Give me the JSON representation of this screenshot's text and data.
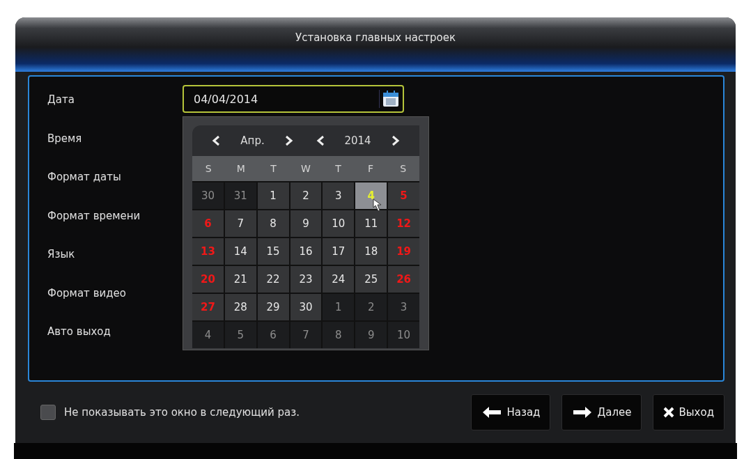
{
  "window": {
    "title": "Установка главных настроек"
  },
  "fields": [
    {
      "label": "Дата",
      "value": "04/04/2014"
    },
    {
      "label": "Время"
    },
    {
      "label": "Формат даты"
    },
    {
      "label": "Формат времени"
    },
    {
      "label": "Язык"
    },
    {
      "label": "Формат видео"
    },
    {
      "label": "Авто выход"
    }
  ],
  "calendar": {
    "month": "Апр.",
    "year": "2014",
    "weekdays": [
      "S",
      "M",
      "T",
      "W",
      "T",
      "F",
      "S"
    ],
    "weeks": [
      [
        {
          "day": "30",
          "kind": "other",
          "weekend": false,
          "selected": false
        },
        {
          "day": "31",
          "kind": "other",
          "weekend": false,
          "selected": false
        },
        {
          "day": "1",
          "kind": "current",
          "weekend": false,
          "selected": false
        },
        {
          "day": "2",
          "kind": "current",
          "weekend": false,
          "selected": false
        },
        {
          "day": "3",
          "kind": "current",
          "weekend": false,
          "selected": false
        },
        {
          "day": "4",
          "kind": "current",
          "weekend": false,
          "selected": true
        },
        {
          "day": "5",
          "kind": "current",
          "weekend": true,
          "selected": false
        }
      ],
      [
        {
          "day": "6",
          "kind": "current",
          "weekend": true,
          "selected": false
        },
        {
          "day": "7",
          "kind": "current",
          "weekend": false,
          "selected": false
        },
        {
          "day": "8",
          "kind": "current",
          "weekend": false,
          "selected": false
        },
        {
          "day": "9",
          "kind": "current",
          "weekend": false,
          "selected": false
        },
        {
          "day": "10",
          "kind": "current",
          "weekend": false,
          "selected": false
        },
        {
          "day": "11",
          "kind": "current",
          "weekend": false,
          "selected": false
        },
        {
          "day": "12",
          "kind": "current",
          "weekend": true,
          "selected": false
        }
      ],
      [
        {
          "day": "13",
          "kind": "current",
          "weekend": true,
          "selected": false
        },
        {
          "day": "14",
          "kind": "current",
          "weekend": false,
          "selected": false
        },
        {
          "day": "15",
          "kind": "current",
          "weekend": false,
          "selected": false
        },
        {
          "day": "16",
          "kind": "current",
          "weekend": false,
          "selected": false
        },
        {
          "day": "17",
          "kind": "current",
          "weekend": false,
          "selected": false
        },
        {
          "day": "18",
          "kind": "current",
          "weekend": false,
          "selected": false
        },
        {
          "day": "19",
          "kind": "current",
          "weekend": true,
          "selected": false
        }
      ],
      [
        {
          "day": "20",
          "kind": "current",
          "weekend": true,
          "selected": false
        },
        {
          "day": "21",
          "kind": "current",
          "weekend": false,
          "selected": false
        },
        {
          "day": "22",
          "kind": "current",
          "weekend": false,
          "selected": false
        },
        {
          "day": "23",
          "kind": "current",
          "weekend": false,
          "selected": false
        },
        {
          "day": "24",
          "kind": "current",
          "weekend": false,
          "selected": false
        },
        {
          "day": "25",
          "kind": "current",
          "weekend": false,
          "selected": false
        },
        {
          "day": "26",
          "kind": "current",
          "weekend": true,
          "selected": false
        }
      ],
      [
        {
          "day": "27",
          "kind": "current",
          "weekend": true,
          "selected": false
        },
        {
          "day": "28",
          "kind": "current",
          "weekend": false,
          "selected": false
        },
        {
          "day": "29",
          "kind": "current",
          "weekend": false,
          "selected": false
        },
        {
          "day": "30",
          "kind": "current",
          "weekend": false,
          "selected": false
        },
        {
          "day": "1",
          "kind": "other",
          "weekend": false,
          "selected": false
        },
        {
          "day": "2",
          "kind": "other",
          "weekend": false,
          "selected": false
        },
        {
          "day": "3",
          "kind": "other",
          "weekend": false,
          "selected": false
        }
      ],
      [
        {
          "day": "4",
          "kind": "other",
          "weekend": false,
          "selected": false
        },
        {
          "day": "5",
          "kind": "other",
          "weekend": false,
          "selected": false
        },
        {
          "day": "6",
          "kind": "other",
          "weekend": false,
          "selected": false
        },
        {
          "day": "7",
          "kind": "other",
          "weekend": false,
          "selected": false
        },
        {
          "day": "8",
          "kind": "other",
          "weekend": false,
          "selected": false
        },
        {
          "day": "9",
          "kind": "other",
          "weekend": false,
          "selected": false
        },
        {
          "day": "10",
          "kind": "other",
          "weekend": false,
          "selected": false
        }
      ]
    ]
  },
  "footer": {
    "checkbox": {
      "label": "Не показывать это окно в следующий раз.",
      "checked": false
    },
    "buttons": [
      {
        "label": "Назад",
        "kind": "back"
      },
      {
        "label": "Далее",
        "kind": "next"
      },
      {
        "label": "Выход",
        "kind": "exit"
      }
    ]
  }
}
